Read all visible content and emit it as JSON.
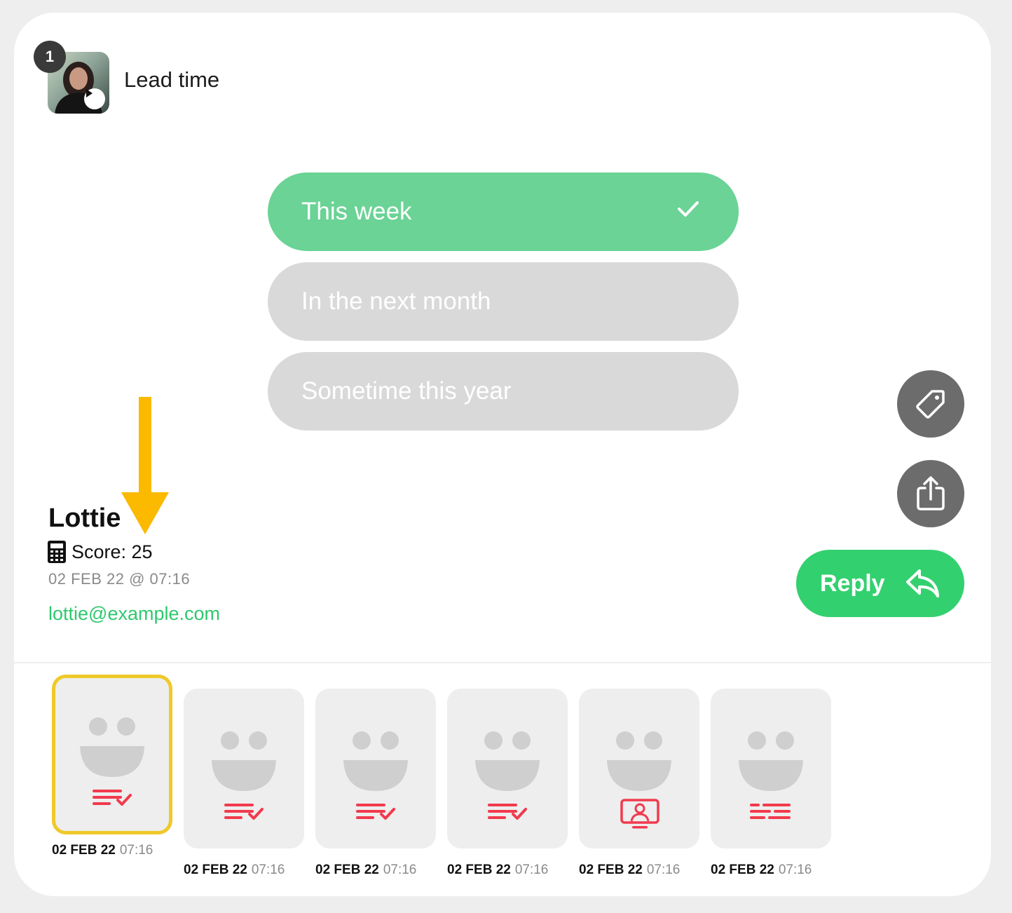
{
  "question": {
    "number": "1",
    "title": "Lead time"
  },
  "options": [
    {
      "label": "This week",
      "selected": true
    },
    {
      "label": "In the next month",
      "selected": false
    },
    {
      "label": "Sometime this year",
      "selected": false
    }
  ],
  "contact": {
    "name": "Lottie",
    "score_text": "Score: 25",
    "timestamp": "02 FEB 22 @ 07:16",
    "email": "lottie@example.com"
  },
  "actions": {
    "reply_label": "Reply",
    "tag_icon": "tag-icon",
    "share_icon": "share-icon"
  },
  "colors": {
    "selected_option": "#6ad395",
    "unselected_option": "#d9d9d9",
    "reply": "#33d06f",
    "email": "#2fc86e",
    "highlight": "#efc92a",
    "arrow": "#fbb900",
    "type_icon": "#f23a4d"
  },
  "thumbnails": [
    {
      "date": "02 FEB 22",
      "time": "07:16",
      "type_icon": "text-check-icon",
      "active": true
    },
    {
      "date": "02 FEB 22",
      "time": "07:16",
      "type_icon": "text-check-icon",
      "active": false
    },
    {
      "date": "02 FEB 22",
      "time": "07:16",
      "type_icon": "text-check-icon",
      "active": false
    },
    {
      "date": "02 FEB 22",
      "time": "07:16",
      "type_icon": "text-check-icon",
      "active": false
    },
    {
      "date": "02 FEB 22",
      "time": "07:16",
      "type_icon": "video-person-icon",
      "active": false
    },
    {
      "date": "02 FEB 22",
      "time": "07:16",
      "type_icon": "text-lines-icon",
      "active": false
    }
  ]
}
